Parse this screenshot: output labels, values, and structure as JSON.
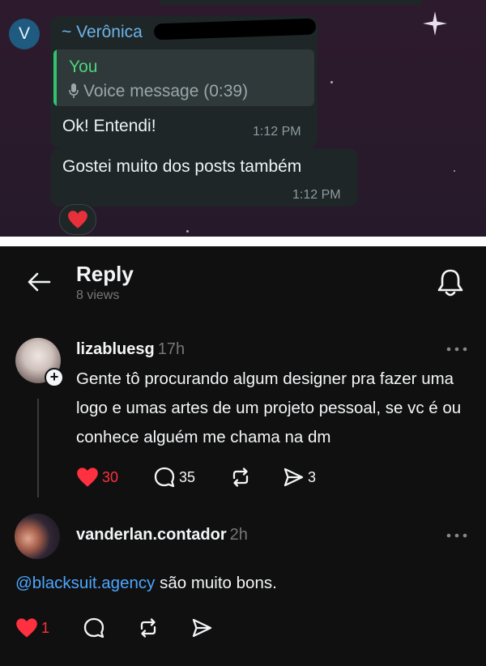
{
  "chat": {
    "avatar_letter": "V",
    "sender_name": "~ Verônica",
    "quote_author": "You",
    "quote_text": "Voice message (0:39)",
    "messages": [
      {
        "text": "Ok! Entendi!",
        "time": "1:12 PM"
      },
      {
        "text": "Gostei muito dos posts também",
        "time": "1:12 PM"
      }
    ],
    "reaction": "heart"
  },
  "header": {
    "title": "Reply",
    "views": "8 views",
    "back_icon": "arrow-left-icon",
    "notify_icon": "bell-icon"
  },
  "post": {
    "username": "lizabluesg",
    "time": "17h",
    "text": "Gente tô procurando algum designer pra fazer uma logo e umas artes de um projeto pessoal, se vc é ou conhece alguém me chama na dm",
    "likes": "30",
    "replies": "35",
    "shares": "3"
  },
  "reply": {
    "username": "vanderlan.contador",
    "time": "2h",
    "mention": "@blacksuit.agency",
    "text": " são muito bons.",
    "likes": "1"
  },
  "colors": {
    "like_red": "#ff3040",
    "mention_blue": "#4da6ff",
    "telegram_name_blue": "#6db3e8",
    "telegram_quote_green": "#4cd37c"
  }
}
